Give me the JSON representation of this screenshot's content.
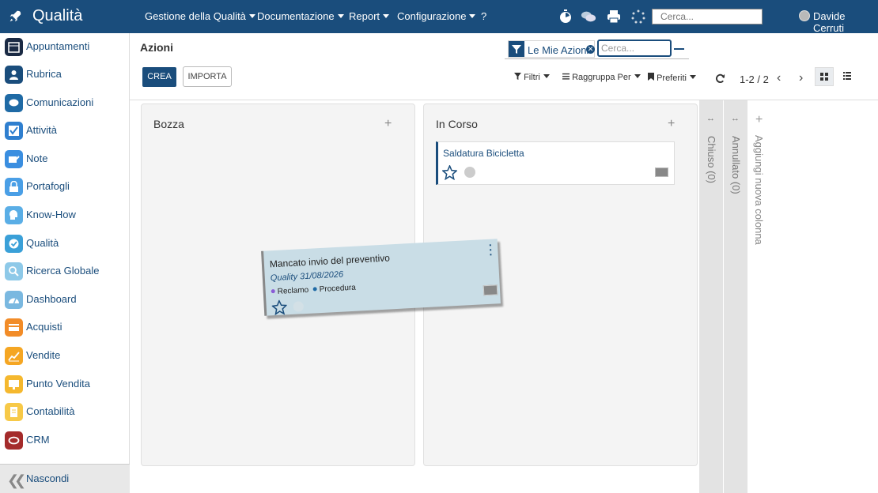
{
  "topbar": {
    "brand": "Qualità",
    "menus": [
      {
        "label": "Gestione della Qualità"
      },
      {
        "label": "Documentazione"
      },
      {
        "label": "Report"
      },
      {
        "label": "Configurazione"
      }
    ],
    "help": "?",
    "search_placeholder": "Cerca...",
    "user": "Davide Cerruti"
  },
  "sidebar": {
    "items": [
      {
        "label": "Appuntamenti",
        "color": "#1a2a44"
      },
      {
        "label": "Rubrica",
        "color": "#1a4d7c"
      },
      {
        "label": "Comunicazioni",
        "color": "#1f6aa5"
      },
      {
        "label": "Attività",
        "color": "#2f7fcf"
      },
      {
        "label": "Note",
        "color": "#3a8ee0"
      },
      {
        "label": "Portafogli",
        "color": "#4a9fe6"
      },
      {
        "label": "Know-How",
        "color": "#5aaee6"
      },
      {
        "label": "Qualità",
        "color": "#3aa0d8"
      },
      {
        "label": "Ricerca Globale",
        "color": "#8ec9e8"
      },
      {
        "label": "Dashboard",
        "color": "#7ab8e0"
      },
      {
        "label": "Acquisti",
        "color": "#f28c28"
      },
      {
        "label": "Vendite",
        "color": "#f5a623"
      },
      {
        "label": "Punto Vendita",
        "color": "#f5b82e"
      },
      {
        "label": "Contabilità",
        "color": "#f7c948"
      },
      {
        "label": "CRM",
        "color": "#a42b2b"
      }
    ],
    "hide_label": "Nascondi"
  },
  "control": {
    "title": "Azioni",
    "create_label": "CREA",
    "import_label": "IMPORTA",
    "facet_label": "Le Mie Azioni",
    "search_placeholder": "Cerca...",
    "filters_label": "Filtri",
    "groupby_label": "Raggruppa Per",
    "favorites_label": "Preferiti",
    "pager": "1-2 / 2"
  },
  "kanban": {
    "columns": [
      {
        "title": "Bozza"
      },
      {
        "title": "In Corso",
        "cards": [
          {
            "title": "Saldatura Bicicletta"
          }
        ]
      }
    ],
    "folded": [
      {
        "title": "Chiuso (0)"
      },
      {
        "title": "Annullato (0)"
      }
    ],
    "add_column": "Aggiungi nuova colonna",
    "dragging_card": {
      "title": "Mancato invio del preventivo",
      "subtitle": "Quality 31/08/2026",
      "tags": [
        {
          "label": "Reclamo",
          "color": "#8a5cd6"
        },
        {
          "label": "Procedura",
          "color": "#1f6aa5"
        }
      ]
    }
  },
  "colors": {
    "primary": "#1a4d7c"
  }
}
